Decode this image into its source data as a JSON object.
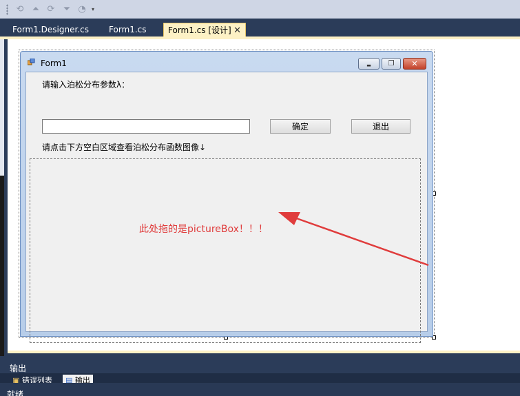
{
  "toolbar": {
    "buttons": [
      "undo-icon",
      "move-up-icon",
      "redo-icon",
      "move-down-icon",
      "history-icon"
    ],
    "dropdown_glyph": "▾"
  },
  "tabs": [
    {
      "label": "Form1.Designer.cs",
      "active": false
    },
    {
      "label": "Form1.cs",
      "active": false
    },
    {
      "label": "Form1.cs [设计]",
      "active": true
    }
  ],
  "tab_close_glyph": "✕",
  "form": {
    "title": "Form1",
    "minimize_glyph": "▬",
    "maximize_glyph": "❐",
    "close_glyph": "✕",
    "prompt_label": "请输入泊松分布参数λ：",
    "input_value": "",
    "confirm_button": "确定",
    "exit_button": "退出",
    "instruction_label": "请点击下方空白区域查看泊松分布函数图像↓"
  },
  "annotation": {
    "text": "此处拖的是pictureBox！！！",
    "color": "#e03c3c"
  },
  "output_panel": {
    "title": "输出",
    "tabs": [
      "错误列表",
      "输出"
    ]
  },
  "status": "就绪",
  "colors": {
    "ide_background": "#2b3c59",
    "active_tab": "#fdf1c5",
    "form_background": "#f0f0f0"
  }
}
